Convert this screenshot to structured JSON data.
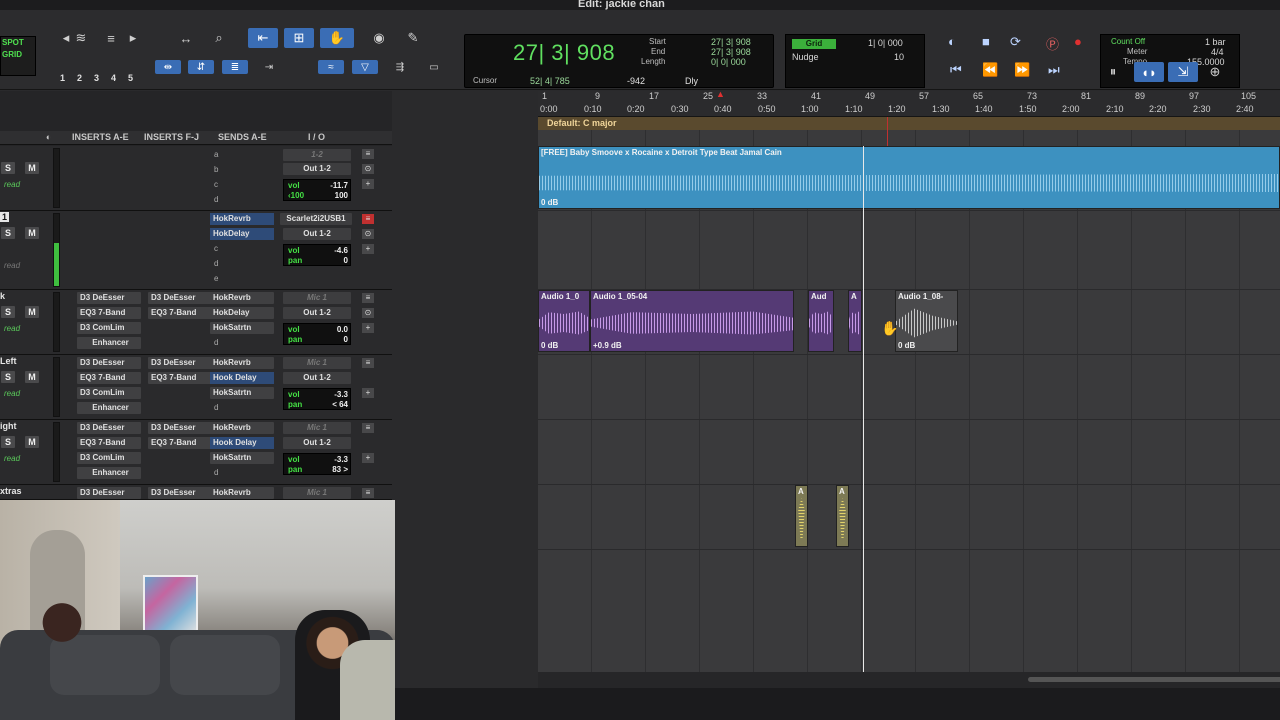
{
  "window": {
    "title": "Edit: jackie chan"
  },
  "toolbar": {
    "mode": [
      "SPOT",
      "GRID"
    ],
    "zoom_presets": [
      "1",
      "2",
      "3",
      "4",
      "5"
    ],
    "counter": {
      "main": "27| 3| 908",
      "start_label": "Start",
      "start_value": "27| 3| 908",
      "end_label": "End",
      "end_value": "27| 3| 908",
      "length_label": "Length",
      "length_value": "0| 0| 000",
      "cursor_label": "Cursor",
      "cursor_value": "52| 4| 785",
      "nudge_amount": "-942",
      "dly_label": "Dly"
    },
    "grid": {
      "grid_label": "Grid",
      "grid_value": "1| 0| 000",
      "nudge_label": "Nudge",
      "nudge_value": "10"
    },
    "meter": {
      "count_off": "Count Off",
      "meter_label": "Meter",
      "tempo_label": "Tempo",
      "bars": "1 bar",
      "signature": "4/4",
      "tempo": "155.0000"
    }
  },
  "mix_columns": {
    "inserts_ae": "INSERTS A-E",
    "inserts_fj": "INSERTS F-J",
    "sends_ae": "SENDS A-E",
    "io": "I / O"
  },
  "tracks": [
    {
      "name": "",
      "inserts_a": [],
      "inserts_f": [],
      "sends": [
        "a",
        "b",
        "c",
        "d"
      ],
      "send_names": [
        "",
        "",
        "",
        ""
      ],
      "input": "1-2",
      "output": "Out 1-2",
      "vol": "-11.7",
      "pan_l": "100",
      "pan_r": "100",
      "mode": "read"
    },
    {
      "name": "1",
      "inserts_a": [],
      "inserts_f": [],
      "sends": [
        "a",
        "b",
        "c",
        "d",
        "e"
      ],
      "send_names": [
        "HokRevrb",
        "HokDelay",
        "",
        "",
        ""
      ],
      "input": "Scarlet2i2USB1",
      "output": "Out 1-2",
      "vol": "-4.6",
      "pan": "0",
      "mode": "read"
    },
    {
      "name": "k",
      "inserts_a": [
        "D3 DeEsser",
        "EQ3 7-Band",
        "D3 ComLim",
        "Enhancer"
      ],
      "inserts_f": [
        "D3 DeEsser",
        "EQ3 7-Band"
      ],
      "sends": [
        "a",
        "b",
        "c",
        "d"
      ],
      "send_names": [
        "HokRevrb",
        "HokDelay",
        "HokSatrtn",
        ""
      ],
      "input": "Mic 1",
      "output": "Out 1-2",
      "vol": "0.0",
      "pan": "0",
      "mode": "read"
    },
    {
      "name": "Left",
      "inserts_a": [
        "D3 DeEsser",
        "EQ3 7-Band",
        "D3 ComLim",
        "Enhancer"
      ],
      "inserts_f": [
        "D3 DeEsser",
        "EQ3 7-Band"
      ],
      "sends": [
        "a",
        "b",
        "c",
        "d"
      ],
      "send_names": [
        "HokRevrb",
        "Hook Delay",
        "HokSatrtn",
        ""
      ],
      "input": "Mic 1",
      "output": "Out 1-2",
      "vol": "-3.3",
      "pan": "< 64",
      "mode": "read"
    },
    {
      "name": "ight",
      "inserts_a": [
        "D3 DeEsser",
        "EQ3 7-Band",
        "D3 ComLim",
        "Enhancer"
      ],
      "inserts_f": [
        "D3 DeEsser",
        "EQ3 7-Band"
      ],
      "sends": [
        "a",
        "b",
        "c",
        "d"
      ],
      "send_names": [
        "HokRevrb",
        "Hook Delay",
        "HokSatrtn",
        ""
      ],
      "input": "Mic 1",
      "output": "Out 1-2",
      "vol": "-3.3",
      "pan": "83 >",
      "mode": "read"
    },
    {
      "name": "xtras",
      "inserts_a": [
        "D3 DeEsser"
      ],
      "inserts_f": [
        "D3 DeEsser"
      ],
      "sends": [
        "a"
      ],
      "send_names": [
        "HokRevrb"
      ],
      "input": "Mic 1"
    }
  ],
  "ruler": {
    "bars": [
      "1",
      "9",
      "17",
      "25",
      "33",
      "41",
      "49",
      "57",
      "65",
      "73",
      "81",
      "89",
      "97",
      "105"
    ],
    "times": [
      "0:00",
      "0:10",
      "0:20",
      "0:30",
      "0:40",
      "0:50",
      "1:00",
      "1:10",
      "1:20",
      "1:30",
      "1:40",
      "1:50",
      "2:00",
      "2:10",
      "2:20",
      "2:30",
      "2:40"
    ]
  },
  "key_signature": "Default: C major",
  "clips": {
    "beat": {
      "name": "[FREE] Baby Smoove x Rocaine x Detroit Type Beat Jamal Cain",
      "gain": "0 dB"
    },
    "vocal1": {
      "name": "Audio 1_0",
      "gain": "0 dB"
    },
    "vocal2": {
      "name": "Audio 1_05-04",
      "gain": "+0.9 dB"
    },
    "vocal3": {
      "name": "Aud"
    },
    "vocal4": {
      "name": "A"
    },
    "vocal5": {
      "name": "Audio 1_08-",
      "gain": "0 dB"
    },
    "extra1": {
      "name": "A"
    },
    "extra2": {
      "name": "A"
    }
  }
}
